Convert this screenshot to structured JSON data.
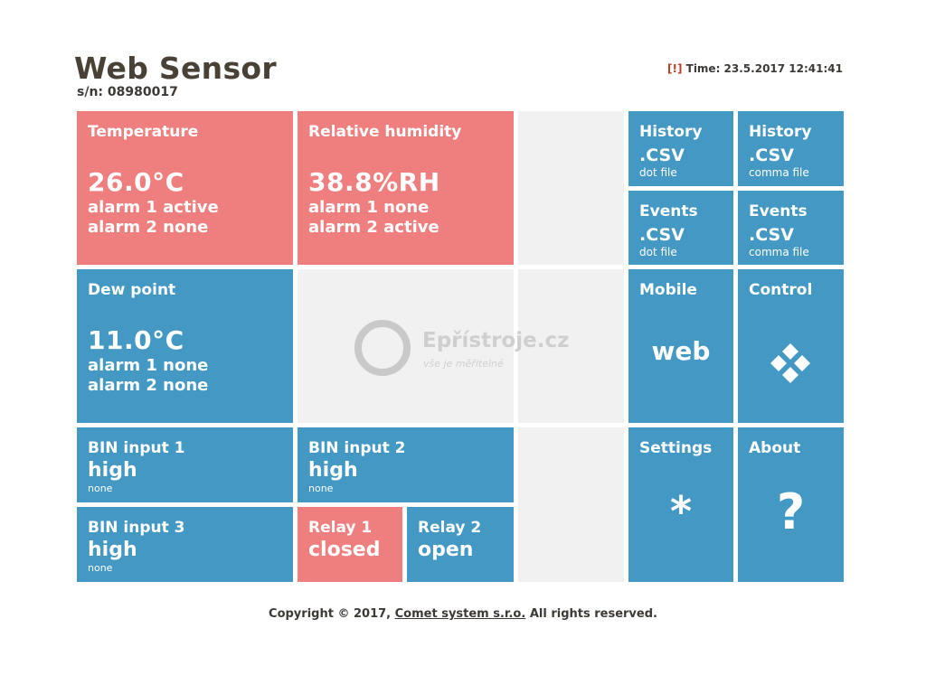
{
  "header": {
    "title": "Web Sensor",
    "serial": "s/n: 08980017",
    "warning": "[!]",
    "time": " Time: 23.5.2017 12:41:41"
  },
  "tiles": {
    "temperature": {
      "label": "Temperature",
      "value": "26.0°C",
      "alarm1": "alarm 1 active",
      "alarm2": "alarm 2 none"
    },
    "humidity": {
      "label": "Relative humidity",
      "value": "38.8%RH",
      "alarm1": "alarm 1 none",
      "alarm2": "alarm 2 active"
    },
    "dewpoint": {
      "label": "Dew point",
      "value": "11.0°C",
      "alarm1": "alarm 1 none",
      "alarm2": "alarm 2 none"
    },
    "bin1": {
      "label": "BIN input 1",
      "state": "high",
      "note": "none"
    },
    "bin2": {
      "label": "BIN input 2",
      "state": "high",
      "note": "none"
    },
    "bin3": {
      "label": "BIN input 3",
      "state": "high",
      "note": "none"
    },
    "relay1": {
      "label": "Relay 1",
      "state": "closed"
    },
    "relay2": {
      "label": "Relay 2",
      "state": "open"
    },
    "history_dot": {
      "label": "History",
      "format": ".CSV",
      "note": "dot file"
    },
    "history_comma": {
      "label": "History",
      "format": ".CSV",
      "note": "comma file"
    },
    "events_dot": {
      "label": "Events",
      "format": ".CSV",
      "note": "dot file"
    },
    "events_comma": {
      "label": "Events",
      "format": ".CSV",
      "note": "comma file"
    },
    "mobile": {
      "label": "Mobile",
      "text": "web"
    },
    "control": {
      "label": "Control",
      "icon": "diamond-grid-icon"
    },
    "settings": {
      "label": "Settings",
      "symbol": "*"
    },
    "about": {
      "label": "About",
      "symbol": "?"
    }
  },
  "watermark": {
    "brand": "Epřístroje.cz",
    "tagline": "vše je měřitelné"
  },
  "footer": {
    "prefix": "Copyright © 2017, ",
    "company": "Comet system s.r.o.",
    "suffix": " All rights reserved."
  },
  "colors": {
    "blue": "#4498c4",
    "red": "#ef7f7f",
    "grey": "#f1f1f1",
    "text": "#3d3a36"
  }
}
